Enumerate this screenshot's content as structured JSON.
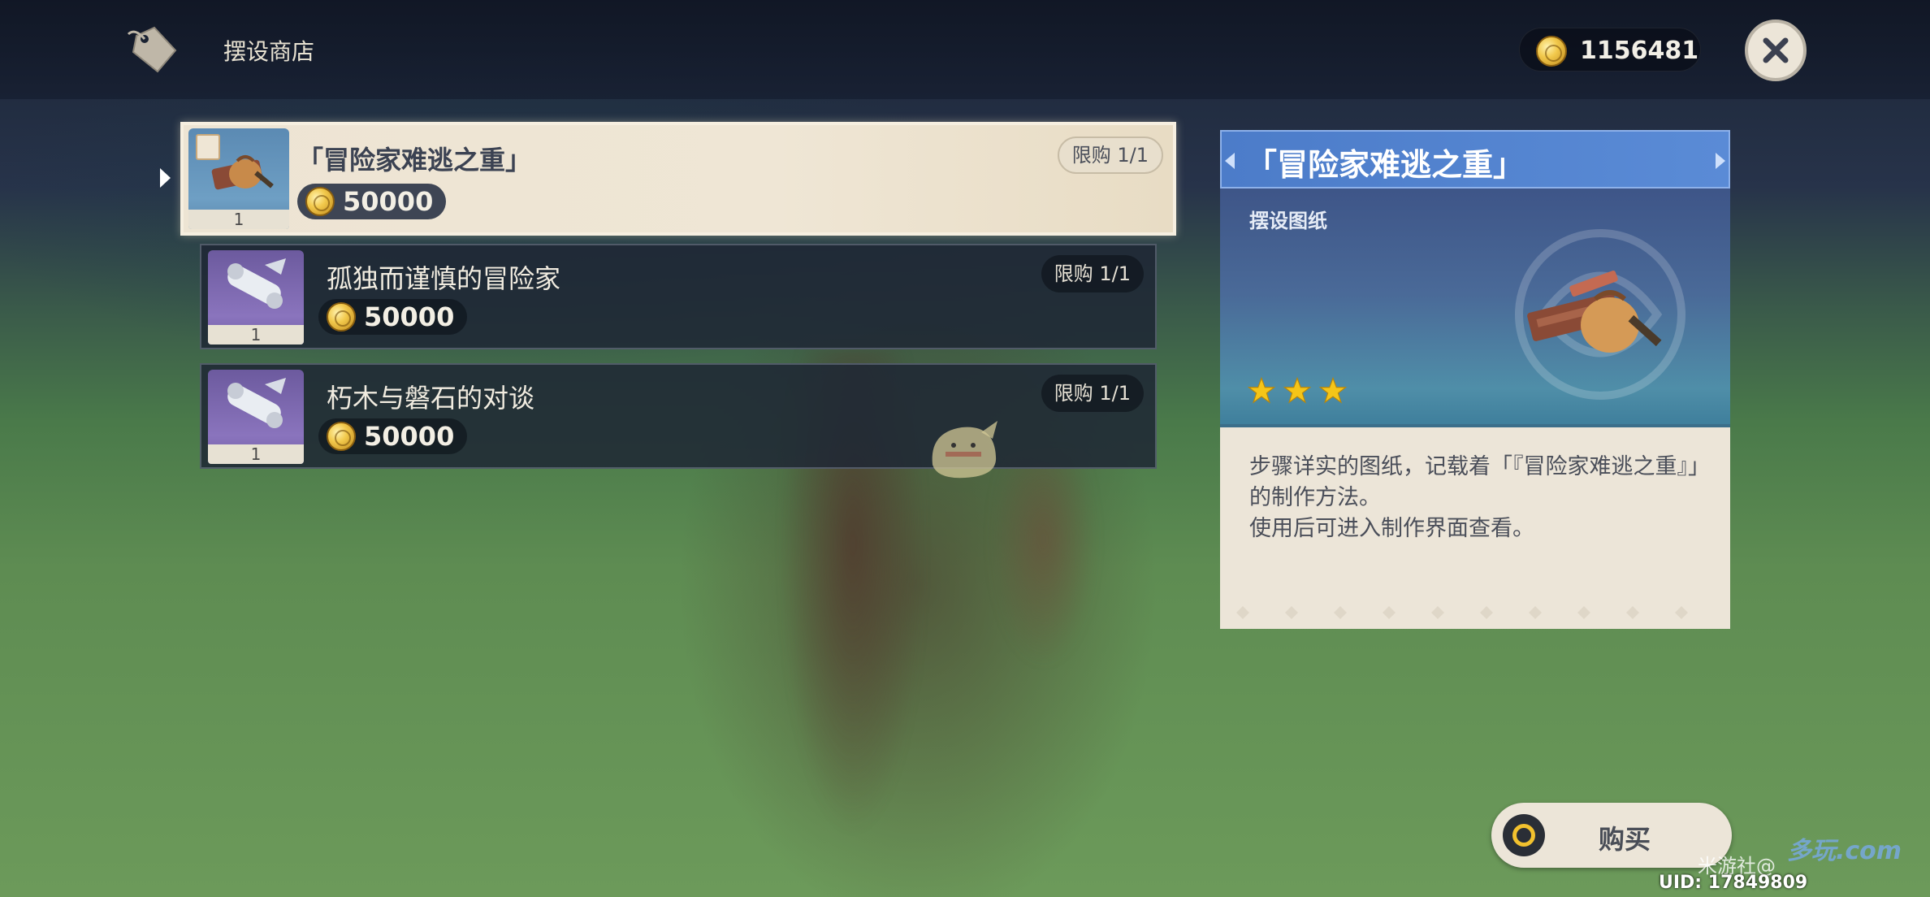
{
  "header": {
    "shop_title": "摆设商店",
    "coins": "1156481",
    "icons": {
      "shop": "price-tag-icon",
      "coin": "mora-coin-icon",
      "close": "close-icon"
    }
  },
  "items": [
    {
      "name": "「冒险家难逃之重」",
      "price": "50000",
      "limit": "限购 1/1",
      "count": "1",
      "selected": true,
      "thumb": "adventurer-bag-icon"
    },
    {
      "name": "孤独而谨慎的冒险家",
      "price": "50000",
      "limit": "限购 1/1",
      "count": "1",
      "selected": false,
      "thumb": "blueprint-scroll-icon"
    },
    {
      "name": "朽木与磐石的对谈",
      "price": "50000",
      "limit": "限购 1/1",
      "count": "1",
      "selected": false,
      "thumb": "blueprint-scroll-icon"
    }
  ],
  "detail": {
    "title": "「冒险家难逃之重」",
    "type": "摆设图纸",
    "rarity_stars": 3,
    "description_1": "步骤详实的图纸，记载着「『冒险家难逃之重』」的制作方法。",
    "description_2": "使用后可进入制作界面查看。"
  },
  "actions": {
    "buy_label": "购买"
  },
  "overlay": {
    "uid": "UID: 17849809",
    "watermark_social": "米游社@",
    "watermark_site": "多玩.com"
  },
  "colors": {
    "accent_blue": "#5a8bd6",
    "panel_beige": "#ece5d8",
    "star_gold": "#f5c518",
    "purple_rarity": "#8a74bd",
    "blue_rarity": "#6e9fc4"
  }
}
